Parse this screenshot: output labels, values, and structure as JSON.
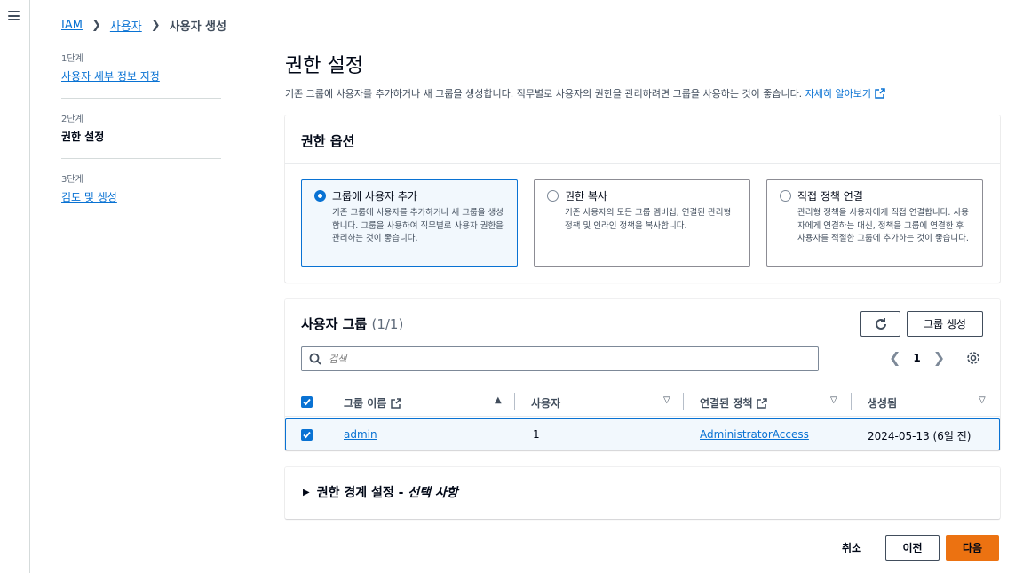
{
  "breadcrumb": {
    "items": [
      "IAM",
      "사용자"
    ],
    "current": "사용자 생성"
  },
  "steps": [
    {
      "num": "1단계",
      "label": "사용자 세부 정보 지정"
    },
    {
      "num": "2단계",
      "label": "권한 설정"
    },
    {
      "num": "3단계",
      "label": "검토 및 생성"
    }
  ],
  "page": {
    "title": "권한 설정",
    "description": "기존 그룹에 사용자를 추가하거나 새 그룹을 생성합니다. 직무별로 사용자의 권한을 관리하려면 그룹을 사용하는 것이 좋습니다. ",
    "learn_more": "자세히 알아보기"
  },
  "options": {
    "title": "권한 옵션",
    "items": [
      {
        "title": "그룹에 사용자 추가",
        "desc": "기존 그룹에 사용자를 추가하거나 새 그룹을 생성합니다. 그룹을 사용하여 직무별로 사용자 권한을 관리하는 것이 좋습니다.",
        "selected": true
      },
      {
        "title": "권한 복사",
        "desc": "기존 사용자의 모든 그룹 멤버십, 연결된 관리형 정책 및 인라인 정책을 복사합니다.",
        "selected": false
      },
      {
        "title": "직접 정책 연결",
        "desc": "관리형 정책을 사용자에게 직접 연결합니다. 사용자에게 연결하는 대신, 정책을 그룹에 연결한 후 사용자를 적절한 그룹에 추가하는 것이 좋습니다.",
        "selected": false
      }
    ]
  },
  "groups": {
    "title": "사용자 그룹",
    "count": "(1/1)",
    "create_label": "그룹 생성",
    "search_placeholder": "검색",
    "page_number": "1",
    "columns": [
      "그룹 이름",
      "사용자",
      "연결된 정책",
      "생성됨"
    ],
    "rows": [
      {
        "name": "admin",
        "users": "1",
        "policy": "AdministratorAccess",
        "created": "2024-05-13 (6일 전)"
      }
    ]
  },
  "boundary": {
    "label": "권한 경계 설정 - ",
    "optional": "선택 사항"
  },
  "footer": {
    "cancel": "취소",
    "prev": "이전",
    "next": "다음"
  },
  "colors": {
    "accent": "#0972d3",
    "primary_button": "#ec7211"
  }
}
